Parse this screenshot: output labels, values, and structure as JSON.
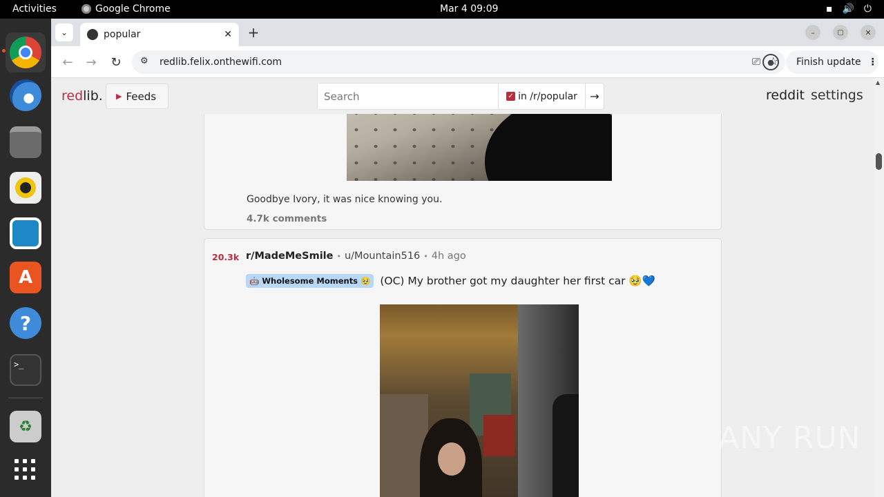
{
  "system": {
    "activities": "Activities",
    "app_name": "Google Chrome",
    "clock": "Mar 4  09:09"
  },
  "browser": {
    "tab_title": "popular",
    "url": "redlib.felix.onthewifi.com",
    "finish_update": "Finish update"
  },
  "redlib": {
    "logo_red": "red",
    "logo_rest": "lib.",
    "feeds_label": "Feeds",
    "search_placeholder": "Search",
    "search_scope": "in /r/popular",
    "nav_reddit": "reddit",
    "nav_settings": "settings"
  },
  "posts": [
    {
      "body": "Goodbye Ivory, it was nice knowing you.",
      "comments": "4.7k comments"
    },
    {
      "score": "20.3k",
      "subreddit": "r/MadeMeSmile",
      "sep": "•",
      "user": "u/Mountain516",
      "age": "4h ago",
      "flair": "Wholesome Moments",
      "title": "(OC) My brother got my daughter her first car 🥹💙"
    }
  ],
  "watermark": "ANY RUN",
  "colors": {
    "accent": "#bb2e3e",
    "flair_bg": "#b8d8f8"
  }
}
